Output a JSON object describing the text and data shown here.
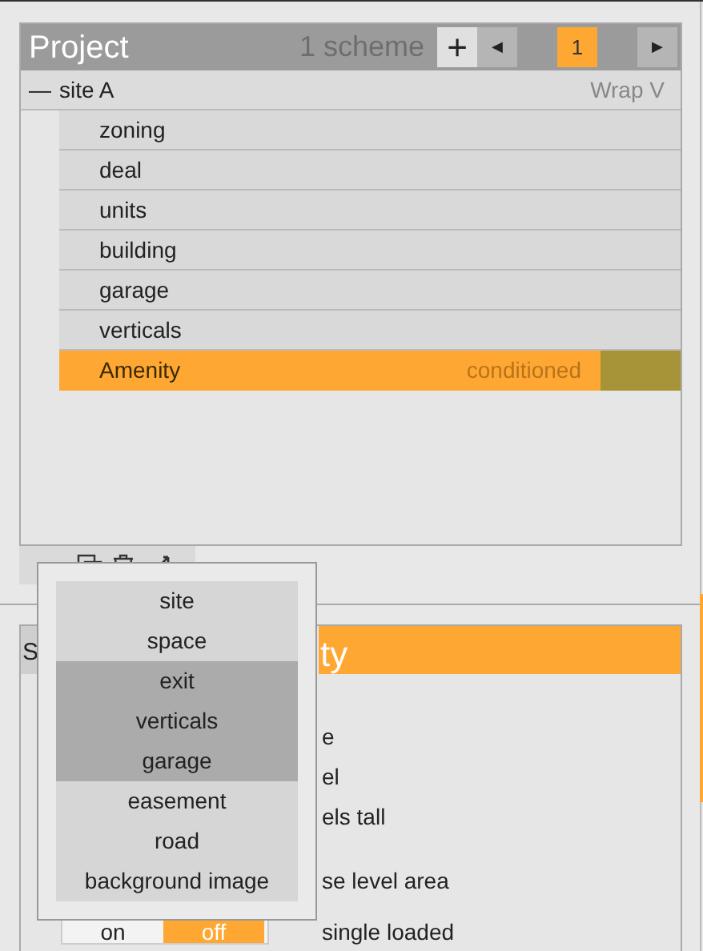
{
  "project": {
    "title": "Project",
    "scheme_count": "1 scheme",
    "add": "+",
    "prev": "◀",
    "page": "1",
    "next": "▶"
  },
  "site": {
    "label": "site A",
    "expanded": true,
    "toggle": "—",
    "wrap": "Wrap V",
    "children": [
      {
        "label": "zoning",
        "selected": false
      },
      {
        "label": "deal",
        "selected": false
      },
      {
        "label": "units",
        "selected": false
      },
      {
        "label": "building",
        "selected": false
      },
      {
        "label": "garage",
        "selected": false
      },
      {
        "label": "verticals",
        "selected": false
      },
      {
        "label": "Amenity",
        "selected": true,
        "tag": "conditioned",
        "color": "#a89438"
      }
    ]
  },
  "add_menu": {
    "items": [
      {
        "label": "site",
        "selected": false
      },
      {
        "label": "space",
        "selected": false
      },
      {
        "label": "exit",
        "selected": true
      },
      {
        "label": "verticals",
        "selected": true
      },
      {
        "label": "garage",
        "selected": true
      },
      {
        "label": "easement",
        "selected": false
      },
      {
        "label": "road",
        "selected": false
      },
      {
        "label": "background image",
        "selected": false
      }
    ]
  },
  "space_panel": {
    "tab": "S",
    "title": "ty",
    "rows": [
      {
        "kind": "label",
        "label": "e"
      },
      {
        "kind": "label",
        "label": "el"
      },
      {
        "kind": "label",
        "label": "els tall"
      },
      {
        "kind": "label",
        "label": "se level area"
      },
      {
        "kind": "toggle",
        "on_label": "on",
        "off_label": "off",
        "on": false,
        "label": "single loaded"
      }
    ]
  }
}
